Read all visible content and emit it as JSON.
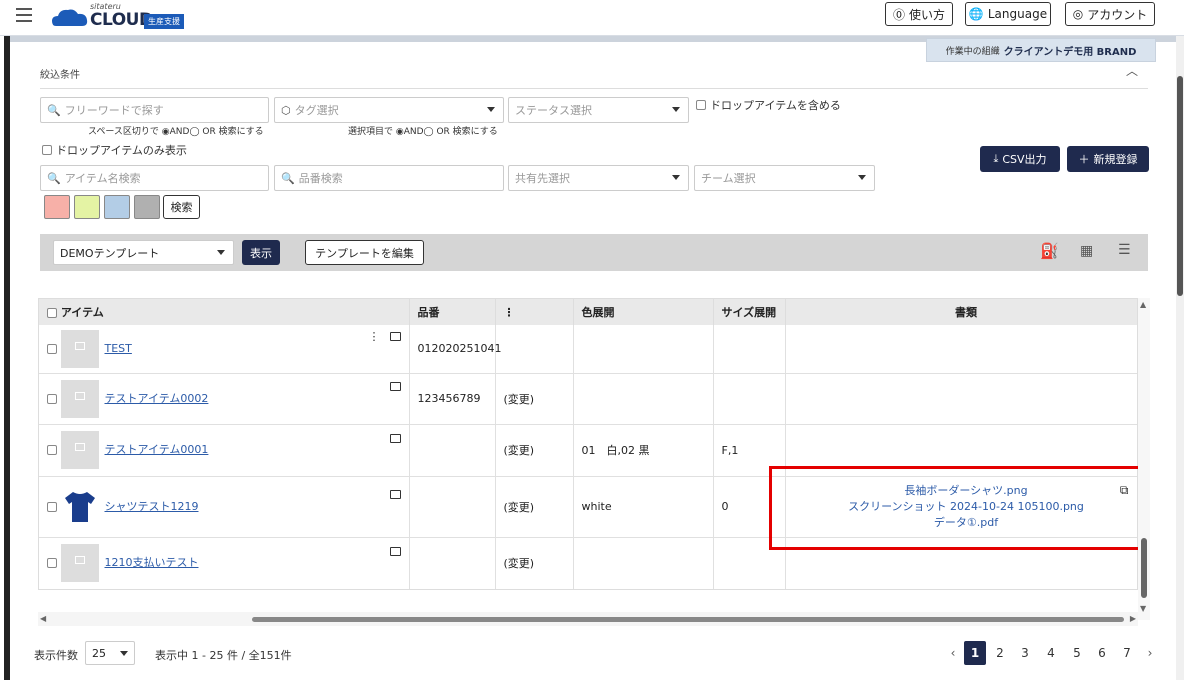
{
  "header": {
    "logo_sub": "sitateru",
    "logo_main": "CLOUD",
    "logo_badge": "生産支援",
    "help": "使い方",
    "language": "Language",
    "account": "アカウント"
  },
  "org": {
    "label": "作業中の組織",
    "name": "クライアントデモ用 BRAND"
  },
  "filter": {
    "title": "絞込条件",
    "freeword_placeholder": "フリーワードで探す",
    "freeword_hint": "スペース区切りで ◉AND◯ OR 検索にする",
    "tag_placeholder": "タグ選択",
    "tag_hint": "選択項目で ◉AND◯ OR 検索にする",
    "status_placeholder": "ステータス選択",
    "include_drop": "ドロップアイテムを含める",
    "only_drop": "ドロップアイテムのみ表示",
    "item_placeholder": "アイテム名検索",
    "partno_placeholder": "品番検索",
    "share_placeholder": "共有先選択",
    "team_placeholder": "チーム選択",
    "search_button": "検索",
    "swatches": [
      "#f7b0a8",
      "#e4f3a4",
      "#b3cde6",
      "#b0b0b0"
    ]
  },
  "actions": {
    "csv": "CSV出力",
    "new": "新規登録"
  },
  "template": {
    "selected": "DEMOテンプレート",
    "show": "表示",
    "edit": "テンプレートを編集"
  },
  "table": {
    "headers": [
      "アイテム",
      "品番",
      "",
      "色展開",
      "サイズ展開",
      "書類"
    ],
    "rows": [
      {
        "name": "TEST",
        "partno": "012020251041",
        "change": "",
        "color": "",
        "size": "",
        "docs": []
      },
      {
        "name": "テストアイテム0002",
        "partno": "123456789",
        "change": "(変更)",
        "color": "",
        "size": "",
        "docs": []
      },
      {
        "name": "テストアイテム0001",
        "partno": "",
        "change": "(変更)",
        "color": "01　白,02 黒",
        "size": "F,1",
        "docs": []
      },
      {
        "name": "シャツテスト1219",
        "partno": "",
        "change": "(変更)",
        "color": "white",
        "size": "0",
        "docs": [
          "長袖ボーダーシャツ.png",
          "スクリーンショット 2024-10-24 105100.png",
          "データ①.pdf"
        ]
      },
      {
        "name": "1210支払いテスト",
        "partno": "",
        "change": "(変更)",
        "color": "",
        "size": "",
        "docs": []
      }
    ]
  },
  "footer": {
    "per_page_label": "表示件数",
    "per_page": "25",
    "range": "表示中 1 - 25 件 / 全151件",
    "pages": [
      "1",
      "2",
      "3",
      "4",
      "5",
      "6",
      "7"
    ]
  },
  "colors": {
    "brand": "#1f2a4e",
    "link": "#2c5ba8",
    "highlight": "#e40000"
  }
}
